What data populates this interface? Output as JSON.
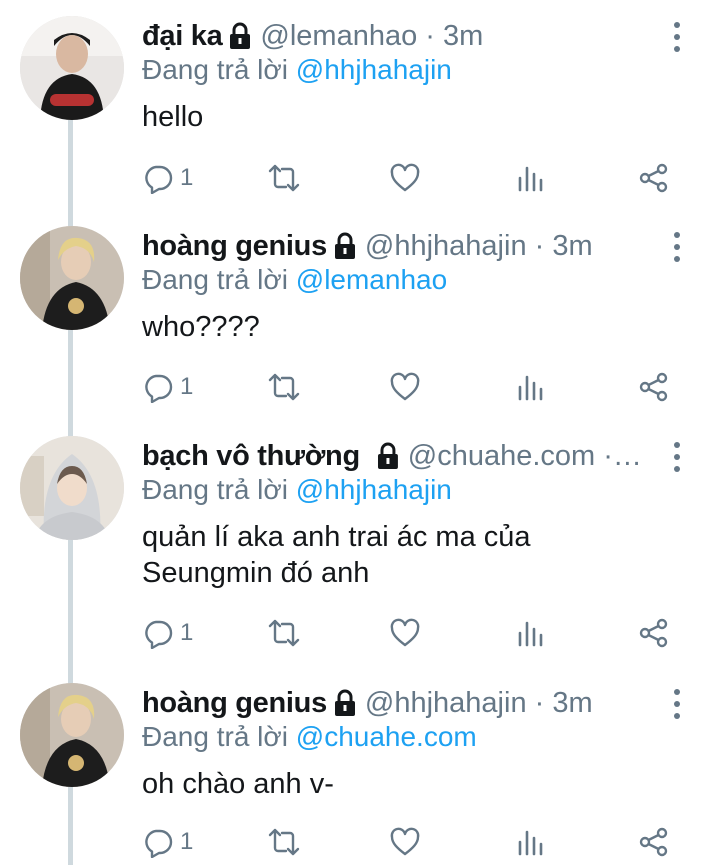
{
  "tweets": [
    {
      "name": "đại ka",
      "handle": "@lemanhao · 3m",
      "reply_prefix": "Đang trả lời ",
      "reply_to": "@hhjhahajin",
      "text": "hello",
      "reply_count": "1",
      "avatar": "avatar-1"
    },
    {
      "name": "hoàng genius",
      "handle": "@hhjhahajin · 3m",
      "reply_prefix": "Đang trả lời ",
      "reply_to": "@lemanhao",
      "text": "who????",
      "reply_count": "1",
      "avatar": "avatar-2"
    },
    {
      "name": "bạch vô thường",
      "handle": "@chuahe.com · …",
      "reply_prefix": "Đang trả lời ",
      "reply_to": "@hhjhahajin",
      "text": "quản lí aka anh trai ác ma của Seungmin đó anh",
      "reply_count": "1",
      "avatar": "avatar-3"
    },
    {
      "name": "hoàng genius",
      "handle": "@hhjhahajin · 3m",
      "reply_prefix": "Đang trả lời ",
      "reply_to": "@chuahe.com",
      "text": "oh chào anh v-",
      "reply_count": "1",
      "avatar": "avatar-2"
    }
  ],
  "icons": {
    "reply": "reply-icon",
    "retweet": "retweet-icon",
    "like": "heart-icon",
    "analytics": "analytics-icon",
    "share": "share-icon",
    "lock": "lock-icon",
    "more": "more-vertical-icon"
  },
  "colors": {
    "accent": "#1da1f2",
    "secondary_text": "#657786",
    "primary_text": "#14171a",
    "thread_line": "#cfd9de"
  }
}
